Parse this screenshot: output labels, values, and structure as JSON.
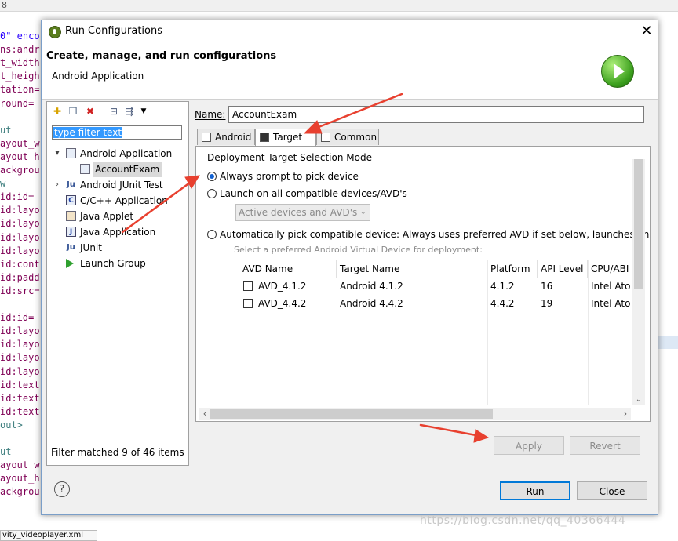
{
  "background_code": {
    "lines": [
      {
        "text": "0\" enco",
        "color": "#2a00ff"
      },
      {
        "text": "ns:andr",
        "color": "#7f0055"
      },
      {
        "text": "t_width",
        "color": "#7f0055"
      },
      {
        "text": "t_heigh",
        "color": "#7f0055"
      },
      {
        "text": "tation=",
        "color": "#7f0055"
      },
      {
        "text": "round=",
        "color": "#7f0055"
      },
      {
        "text": "",
        "color": "#7f0055"
      },
      {
        "text": "ut",
        "color": "#3f7f7f"
      },
      {
        "text": "ayout_w",
        "color": "#7f0055"
      },
      {
        "text": "ayout_h",
        "color": "#7f0055"
      },
      {
        "text": "ackgrou",
        "color": "#7f0055"
      },
      {
        "text": "w",
        "color": "#3f7f7f"
      },
      {
        "text": "id:id=",
        "color": "#7f0055"
      },
      {
        "text": "id:layo",
        "color": "#7f0055"
      },
      {
        "text": "id:layo",
        "color": "#7f0055"
      },
      {
        "text": "id:layo",
        "color": "#7f0055"
      },
      {
        "text": "id:layo",
        "color": "#7f0055"
      },
      {
        "text": "id:cont",
        "color": "#7f0055"
      },
      {
        "text": "id:padd",
        "color": "#7f0055"
      },
      {
        "text": "id:src=",
        "color": "#7f0055"
      },
      {
        "text": "",
        "color": "#7f0055"
      },
      {
        "text": "id:id=",
        "color": "#7f0055"
      },
      {
        "text": "id:layo",
        "color": "#7f0055"
      },
      {
        "text": "id:layo",
        "color": "#7f0055"
      },
      {
        "text": "id:layo",
        "color": "#7f0055"
      },
      {
        "text": "id:layo",
        "color": "#7f0055"
      },
      {
        "text": "id:text",
        "color": "#7f0055"
      },
      {
        "text": "id:text",
        "color": "#7f0055"
      },
      {
        "text": "id:text",
        "color": "#7f0055"
      },
      {
        "text": "out>",
        "color": "#3f7f7f"
      },
      {
        "text": "",
        "color": "#7f0055"
      },
      {
        "text": "ut",
        "color": "#3f7f7f"
      },
      {
        "text": "ayout_w",
        "color": "#7f0055"
      },
      {
        "text": "ayout_h",
        "color": "#7f0055"
      },
      {
        "text": "ackgrou",
        "color": "#7f0055"
      }
    ],
    "topleft_glyph": "8",
    "bottom_tab": "vity_videoplayer.xml"
  },
  "dialog": {
    "title": "Run Configurations",
    "close_glyph": "✕",
    "header_title": "Create, manage, and run configurations",
    "header_subtitle": "Android Application"
  },
  "left_panel": {
    "filter_text": "type filter text",
    "tree": [
      {
        "label": "Android Application",
        "expand": "▾",
        "icon": "ap",
        "level": 0
      },
      {
        "label": "AccountExam",
        "expand": "",
        "icon": "ap",
        "level": 1,
        "selected": true
      },
      {
        "label": "Android JUnit Test",
        "expand": "›",
        "icon": "Ju",
        "level": 0
      },
      {
        "label": "C/C++ Application",
        "expand": "",
        "icon": "C",
        "level": 0
      },
      {
        "label": "Java Applet",
        "expand": "",
        "icon": "ja",
        "level": 0
      },
      {
        "label": "Java Application",
        "expand": "",
        "icon": "J",
        "level": 0
      },
      {
        "label": "JUnit",
        "expand": "",
        "icon": "Ju",
        "level": 0
      },
      {
        "label": "Launch Group",
        "expand": "",
        "icon": "lg",
        "level": 0
      }
    ],
    "status": "Filter matched 9 of 46 items"
  },
  "right_panel": {
    "name_label": "Name:",
    "name_value": "AccountExam",
    "tabs": [
      {
        "label": "Android",
        "active": false
      },
      {
        "label": "Target",
        "active": true
      },
      {
        "label": "Common",
        "active": false
      }
    ],
    "mode_label": "Deployment Target Selection Mode",
    "radio_always": "Always prompt to pick device",
    "radio_launch_all": "Launch on all compatible devices/AVD's",
    "avd_select_value": "Active devices and AVD's",
    "radio_auto": "Automatically pick compatible device: Always uses preferred AVD if set below, launches on",
    "preferred_label": "Select a preferred Android Virtual Device for deployment:",
    "table_headers": [
      "AVD Name",
      "Target Name",
      "Platform",
      "API Level",
      "CPU/ABI"
    ],
    "table_rows": [
      {
        "avd": "AVD_4.1.2",
        "target": "Android 4.1.2",
        "platform": "4.1.2",
        "api": "16",
        "cpu": "Intel Ato"
      },
      {
        "avd": "AVD_4.4.2",
        "target": "Android 4.4.2",
        "platform": "4.4.2",
        "api": "19",
        "cpu": "Intel Ato"
      }
    ]
  },
  "buttons": {
    "apply": "Apply",
    "revert": "Revert",
    "run": "Run",
    "close": "Close",
    "help": "?"
  },
  "colors": {
    "accent": "#0078d7",
    "annotation_arrow": "#e8402f",
    "selection": "#3399ff"
  },
  "watermark": "https://blog.csdn.net/qq_40366444"
}
